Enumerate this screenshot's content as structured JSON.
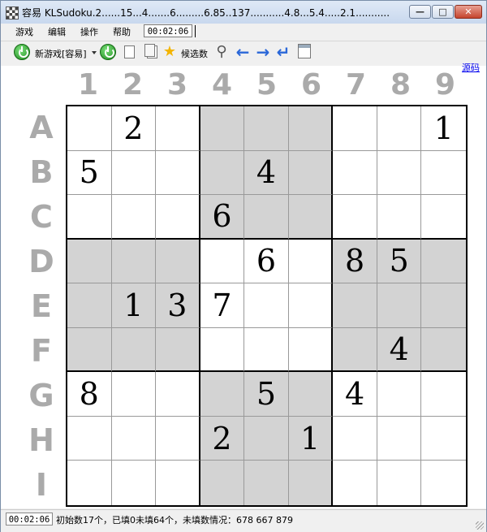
{
  "window": {
    "title": "容易 KLSudoku.2......15...4.......6.........6.85..137...........4.8...5.4.....2.1..........."
  },
  "menu": {
    "items": [
      "游戏",
      "编辑",
      "操作",
      "帮助"
    ],
    "timer": "00:02:06"
  },
  "toolbar": {
    "new_game_label": "新游戏[容易]",
    "candidates_label": "候选数",
    "icons": [
      "power-icon",
      "restart-icon",
      "copy-icon",
      "paste-icon",
      "star-icon",
      "magnifier-icon",
      "arrow-left-icon",
      "arrow-right-icon",
      "undo-arrow-icon",
      "calendar-icon"
    ]
  },
  "link": {
    "source": "源码"
  },
  "board": {
    "col_labels": [
      "1",
      "2",
      "3",
      "4",
      "5",
      "6",
      "7",
      "8",
      "9"
    ],
    "row_labels": [
      "A",
      "B",
      "C",
      "D",
      "E",
      "F",
      "G",
      "H",
      "I"
    ],
    "cells": [
      [
        "",
        "2",
        "",
        "",
        "",
        "",
        "",
        "",
        "1"
      ],
      [
        "5",
        "",
        "",
        "",
        "4",
        "",
        "",
        "",
        ""
      ],
      [
        "",
        "",
        "",
        "6",
        "",
        "",
        "",
        "",
        ""
      ],
      [
        "",
        "",
        "",
        "",
        "6",
        "",
        "8",
        "5",
        ""
      ],
      [
        "",
        "1",
        "3",
        "7",
        "",
        "",
        "",
        "",
        ""
      ],
      [
        "",
        "",
        "",
        "",
        "",
        "",
        "",
        "4",
        ""
      ],
      [
        "8",
        "",
        "",
        "",
        "5",
        "",
        "4",
        "",
        ""
      ],
      [
        "",
        "",
        "",
        "2",
        "",
        "1",
        "",
        "",
        ""
      ],
      [
        "",
        "",
        "",
        "",
        "",
        "",
        "",
        "",
        ""
      ]
    ],
    "shade_color": "#d3d3d3"
  },
  "status": {
    "timer": "00:02:06",
    "text": "初始数17个，已填0未填64个，未填数情况：678 667 879"
  }
}
